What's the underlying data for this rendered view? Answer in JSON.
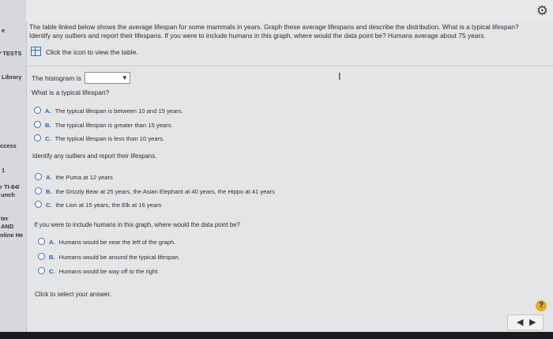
{
  "sidebar": {
    "items": [
      "e",
      "✓TESTS",
      "Library",
      "ccess",
      "1",
      "r TI-84/",
      "unch",
      "ter",
      "AND",
      "nline He"
    ]
  },
  "question": {
    "intro": [
      "The table linked below shows the average lifespan for some mammals in years. Graph these average lifespans and describe the distribution. What is a typical lifespan?",
      "Identify any outliers and report their lifespans. If you were to include humans in this graph, where would the data point be? Humans average about 75 years."
    ],
    "table_link": "Click the icon to view the table."
  },
  "part1": {
    "prompt": "The histogram is",
    "dropdown_value": ""
  },
  "part2": {
    "prompt": "What is a typical lifespan?",
    "options": [
      {
        "letter": "A.",
        "text": "The typical lifespan is between 10 and 15 years."
      },
      {
        "letter": "B.",
        "text": "The typical lifespan is greater than 15 years."
      },
      {
        "letter": "C.",
        "text": "The typical lifespan is less than 10 years."
      }
    ]
  },
  "part3": {
    "prompt": "Identify any outliers and report their lifespans.",
    "options": [
      {
        "letter": "A.",
        "text": "the Puma at 12 years"
      },
      {
        "letter": "B.",
        "text": "the Grizzly Bear at 25 years, the Asian Elephant at 40 years, the Hippo at 41 years"
      },
      {
        "letter": "C.",
        "text": "the Lion at 15 years, the Elk at 16 years"
      }
    ]
  },
  "part4": {
    "prompt": "If you were to include humans in this graph, where would the data point be?",
    "options": [
      {
        "letter": "A.",
        "text": "Humans would be near the left of the graph."
      },
      {
        "letter": "B.",
        "text": "Humans would be around the typical lifespan."
      },
      {
        "letter": "C.",
        "text": "Humans would be way off to the right."
      }
    ]
  },
  "status": "Click to select your answer.",
  "icons": {
    "settings": "⚙",
    "help": "?",
    "prev": "◀",
    "next": "▶",
    "cursor": "I",
    "dropdown": "▼"
  },
  "colors": {
    "accent": "#2d5f9f",
    "help": "#e4a928"
  }
}
